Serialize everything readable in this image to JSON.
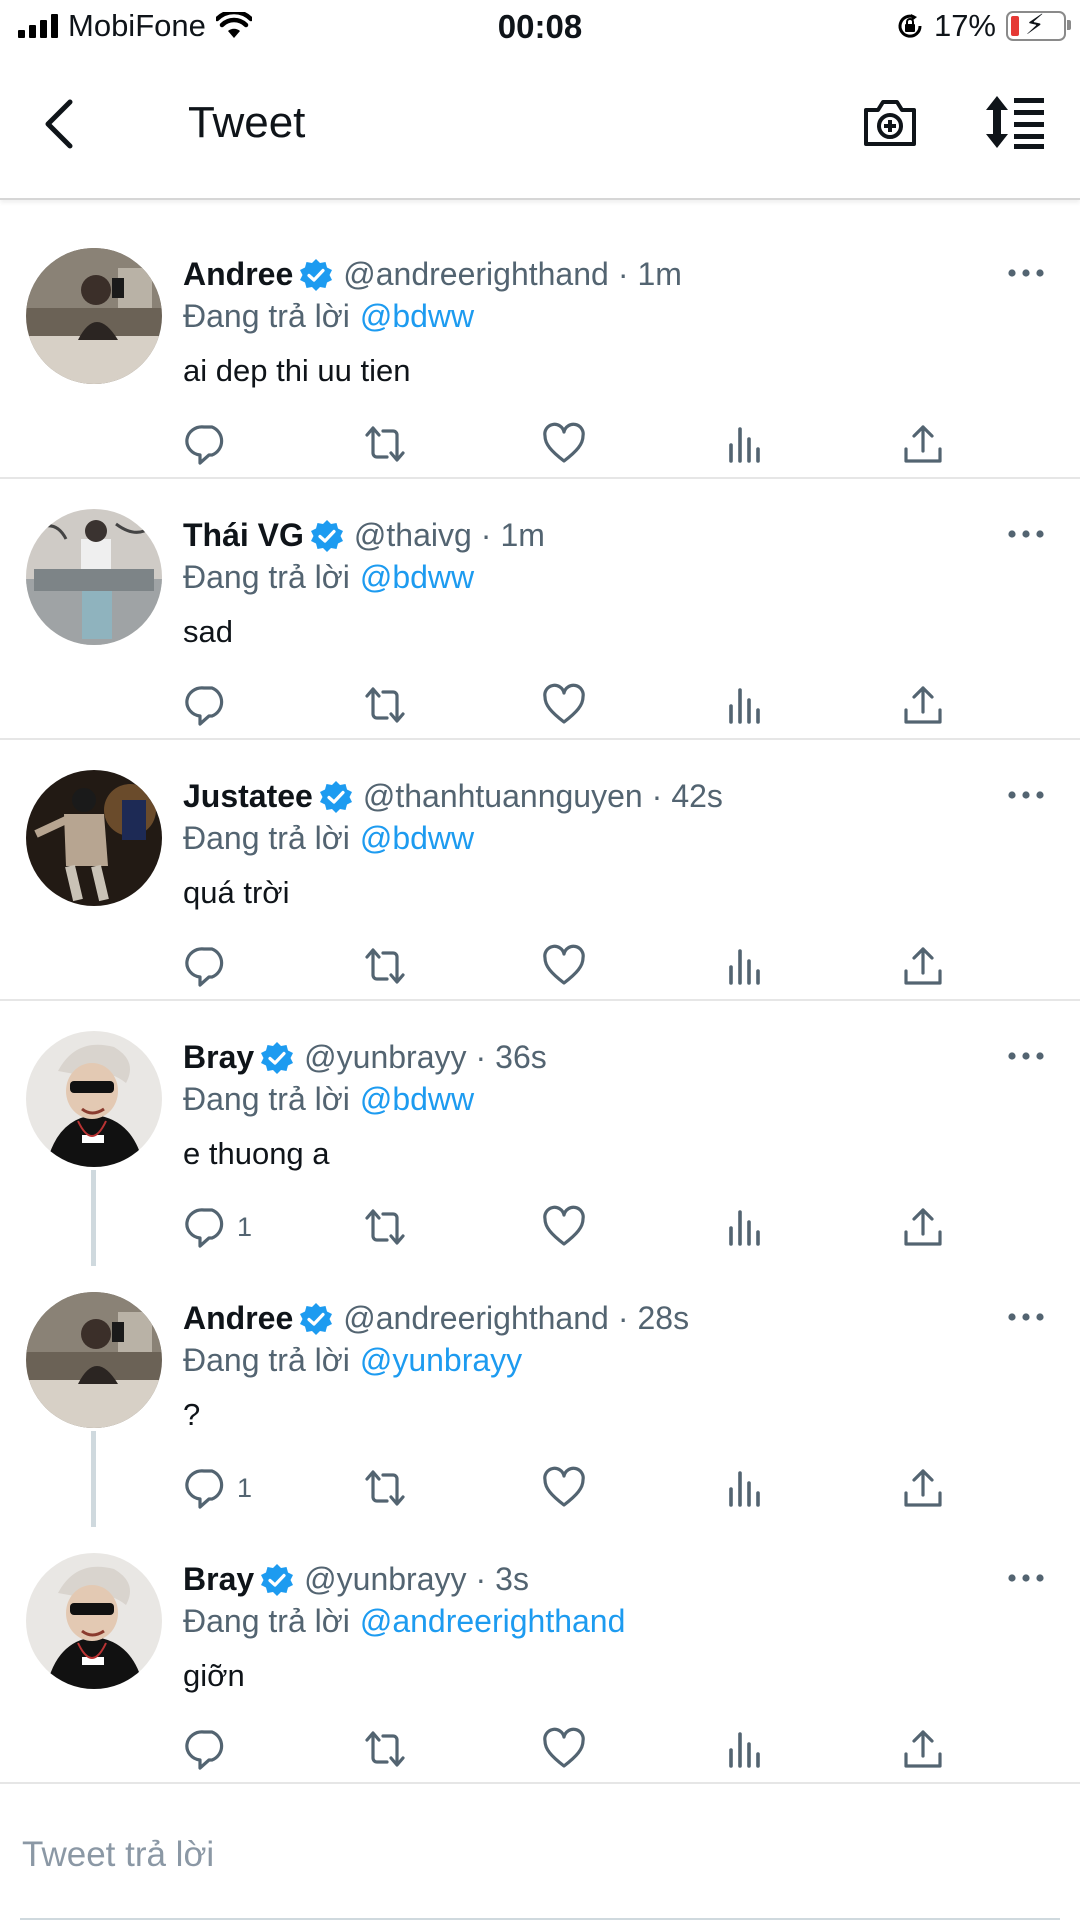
{
  "status_bar": {
    "carrier": "MobiFone",
    "time": "00:08",
    "battery_percent": "17%",
    "battery_level": 0.17,
    "icons": [
      "signal-bars-icon",
      "wifi-icon",
      "orientation-lock-icon",
      "battery-charging-icon"
    ]
  },
  "header": {
    "title": "Tweet",
    "icons": [
      "back-chevron-icon",
      "camera-plus-icon",
      "sort-arrows-icon"
    ]
  },
  "colors": {
    "accent": "#1d9bf0",
    "text": "#0f1419",
    "secondary_text": "#536471",
    "icon": "#536471",
    "divider": "#e6e6e6",
    "battery_low": "#e53935"
  },
  "replying_label": "Đang trả lời",
  "tweets": [
    {
      "name": "Andree",
      "handle": "@andreerighthand",
      "time": "1m",
      "reply_to": "@bdww",
      "text": "ai dep thi uu tien",
      "reply_count": "",
      "verified": true,
      "avatar": "andree-avatar"
    },
    {
      "name": "Thái VG",
      "handle": "@thaivg",
      "time": "1m",
      "reply_to": "@bdww",
      "text": "sad",
      "reply_count": "",
      "verified": true,
      "avatar": "thaivg-avatar"
    },
    {
      "name": "Justatee",
      "handle": "@thanhtuannguyen",
      "time": "42s",
      "reply_to": "@bdww",
      "text": "quá trời",
      "reply_count": "",
      "verified": true,
      "avatar": "justatee-avatar"
    },
    {
      "name": "Bray",
      "handle": "@yunbrayy",
      "time": "36s",
      "reply_to": "@bdww",
      "text": "e thuong a",
      "reply_count": "1",
      "verified": true,
      "avatar": "bray-avatar"
    },
    {
      "name": "Andree",
      "handle": "@andreerighthand",
      "time": "28s",
      "reply_to": "@yunbrayy",
      "text": "?",
      "reply_count": "1",
      "verified": true,
      "avatar": "andree-avatar"
    },
    {
      "name": "Bray",
      "handle": "@yunbrayy",
      "time": "3s",
      "reply_to": "@andreerighthand",
      "text": "giỡn",
      "reply_count": "",
      "verified": true,
      "avatar": "bray-avatar"
    }
  ],
  "action_icons": [
    "reply-icon",
    "retweet-icon",
    "like-icon",
    "analytics-icon",
    "share-icon"
  ],
  "composer": {
    "placeholder": "Tweet trả lời"
  }
}
